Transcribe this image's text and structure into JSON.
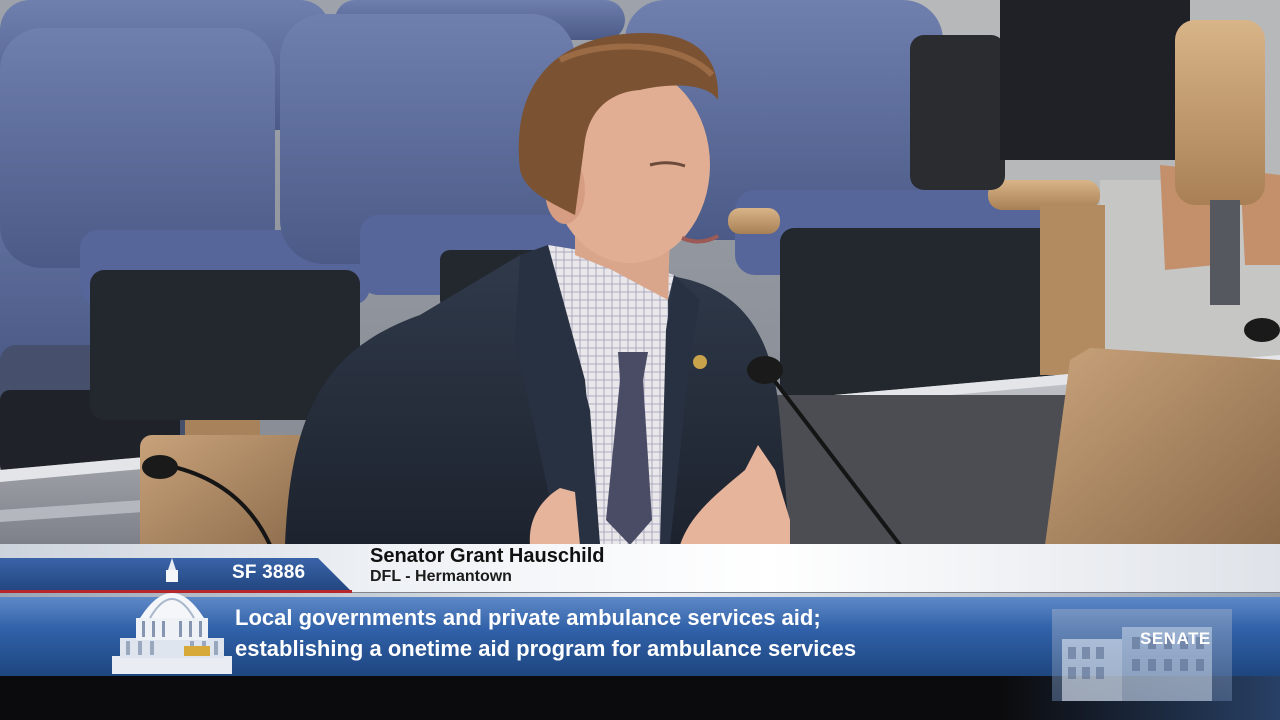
{
  "lower_third": {
    "bill_number": "SF 3886",
    "speaker_name": "Senator Grant Hauschild",
    "speaker_affiliation": "DFL - Hermantown",
    "topic_line1": "Local governments and private ambulance services aid;",
    "topic_line2": "establishing a onetime aid program for ambulance services",
    "network_label": "SENATE"
  },
  "colors": {
    "band_blue": "#2f5fa6",
    "tab_blue": "#21457f",
    "accent_red": "#b4262c",
    "seat_blue": "#5f6f9e",
    "suit": "#252d3a"
  },
  "icons": {
    "capitol": "capitol-dome-icon",
    "building": "senate-building-icon"
  }
}
